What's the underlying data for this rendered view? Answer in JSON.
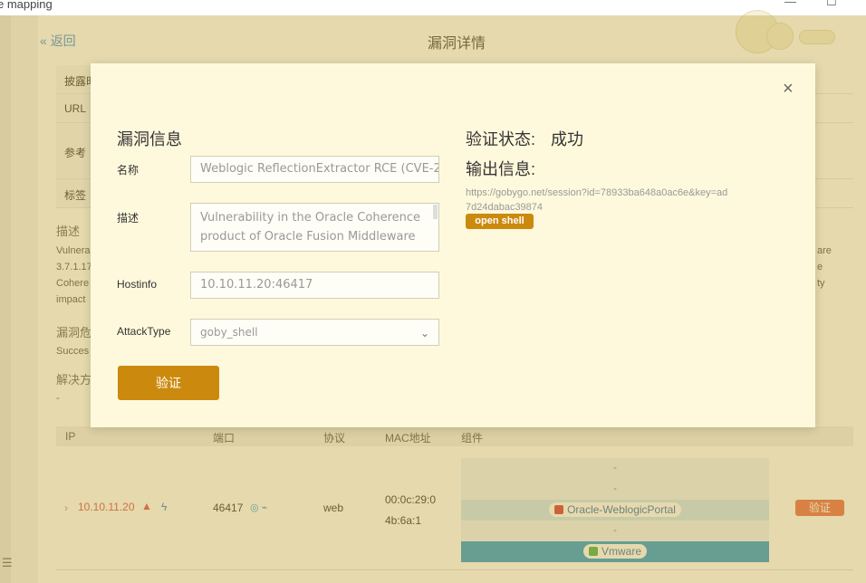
{
  "window": {
    "title": "e mapping",
    "minimize": "—",
    "maximize": "☐"
  },
  "nav": {
    "back_label": "返回",
    "page_title": "漏洞详情"
  },
  "info_table": {
    "rows": [
      "披露时",
      "URL",
      "参考",
      "标签"
    ]
  },
  "sections": {
    "desc_label": "描述",
    "desc_lines": [
      "Vulnera",
      "3.7.1.17",
      "Cohere",
      "impact"
    ],
    "desc_right": [
      "are",
      "e",
      "ty"
    ],
    "harm_label": "漏洞危",
    "harm_text": "Succes",
    "solution_label": "解决方",
    "solution_text": "-"
  },
  "ports_table": {
    "headers": [
      "IP",
      "端口",
      "协议",
      "MAC地址",
      "组件"
    ],
    "row": {
      "ip": "10.10.11.20",
      "port": "46417",
      "protocol": "web",
      "mac": "00:0c:29:04b:6a:1",
      "mac_lines": [
        "00:0c:29:0",
        "4b:6a:1"
      ],
      "components": [
        "-",
        "-",
        "Oracle-WeblogicPortal",
        "-",
        "Vmware"
      ],
      "verify_label": "验证"
    }
  },
  "modal": {
    "section_title": "漏洞信息",
    "name_label": "名称",
    "name_value": "Weblogic ReflectionExtractor RCE (CVE-2",
    "desc_label": "描述",
    "desc_value": "Vulnerability in the Oracle Coherence product of Oracle Fusion Middleware",
    "hostinfo_label": "Hostinfo",
    "hostinfo_value": "10.10.11.20:46417",
    "attacktype_label": "AttackType",
    "attacktype_value": "goby_shell",
    "verify_button": "验证",
    "status_label": "验证状态:",
    "status_value": "成功",
    "output_label": "输出信息:",
    "output_url": "https://gobygo.net/session?id=78933ba648a0ac6e&key=ad7d24dabac39874",
    "open_shell_button": "open shell",
    "close_icon": "×"
  },
  "colors": {
    "accent": "#cb8a0e",
    "overlay": "#bea032",
    "modal_bg": "#fef9dc",
    "danger": "#d9534f",
    "verify_tag": "#e86f50"
  }
}
